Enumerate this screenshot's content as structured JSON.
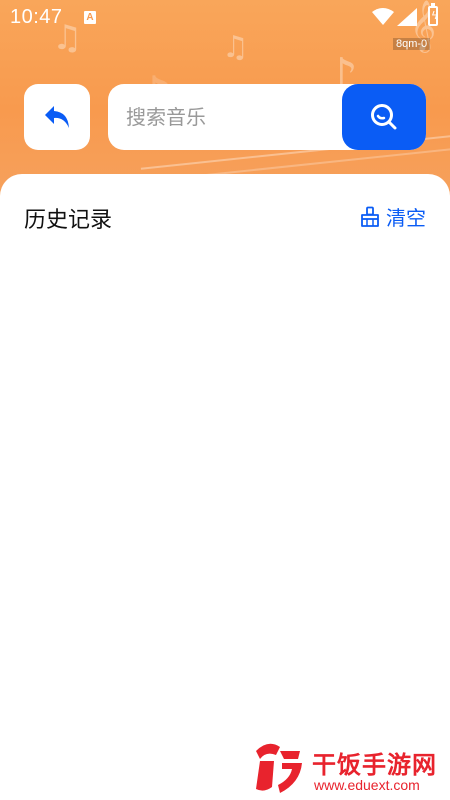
{
  "status_bar": {
    "time": "10:47",
    "notification_icon": "A",
    "debug_tag": "8qm-0"
  },
  "header": {
    "back_icon": "undo-arrow-icon",
    "search": {
      "placeholder": "搜索音乐",
      "value": ""
    },
    "search_icon": "search-icon"
  },
  "history": {
    "title": "历史记录",
    "clear_label": "清空",
    "clear_icon": "broom-icon",
    "items": []
  },
  "watermark": {
    "name": "干饭手游网",
    "url": "www.eduext.com"
  },
  "colors": {
    "accent": "#0a5cf5",
    "hero_orange": "#f89a4e",
    "watermark_red": "#e8232d"
  }
}
